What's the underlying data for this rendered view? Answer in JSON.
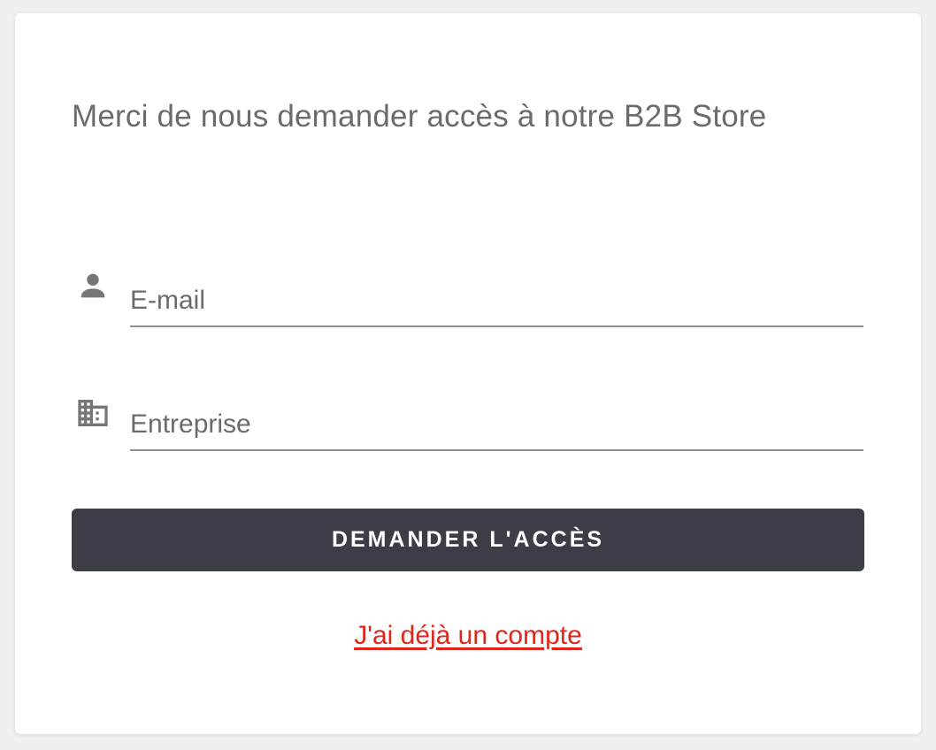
{
  "form": {
    "title": "Merci de nous demander accès à notre B2B Store",
    "email": {
      "placeholder": "E-mail",
      "value": "",
      "icon": "person-icon"
    },
    "company": {
      "placeholder": "Entreprise",
      "value": "",
      "icon": "building-icon"
    },
    "submit_label": "DEMANDER L'ACCÈS",
    "login_link_label": "J'ai déjà un compte"
  },
  "colors": {
    "page_background": "#eff0f0",
    "card_background": "#ffffff",
    "button_background": "#3b3e46",
    "link": "#e0261b",
    "text_muted": "#6b6b6b"
  }
}
